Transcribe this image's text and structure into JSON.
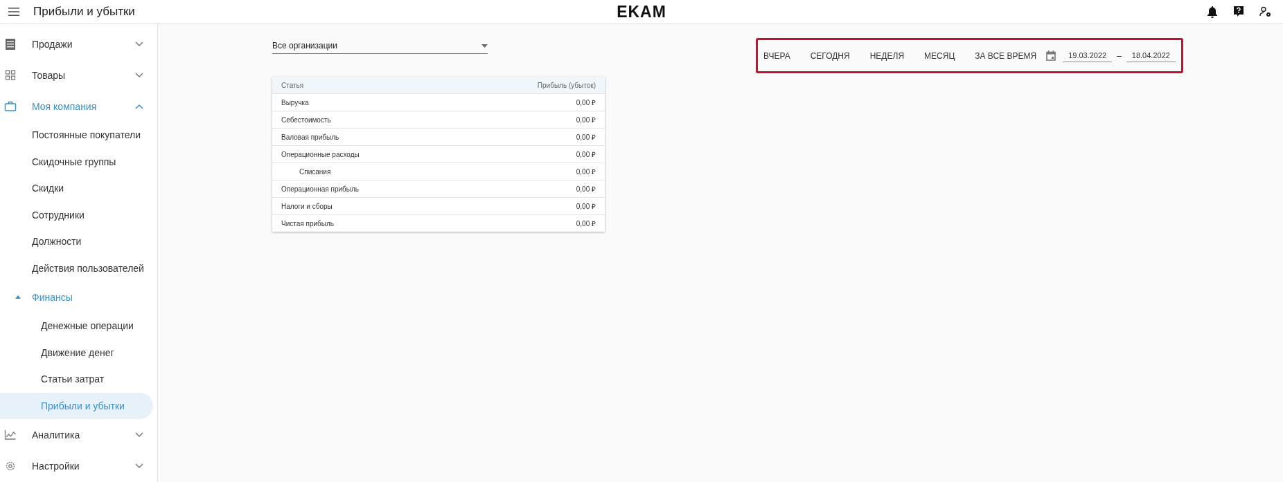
{
  "header": {
    "title": "Прибыли и убытки",
    "logo": "EKAM"
  },
  "sidebar": {
    "items": [
      {
        "label": "Продажи",
        "expanded": false,
        "selected": false
      },
      {
        "label": "Товары",
        "expanded": false,
        "selected": false
      },
      {
        "label": "Моя компания",
        "expanded": true,
        "selected": false,
        "children": [
          {
            "label": "Постоянные покупатели",
            "selected": false
          },
          {
            "label": "Скидочные группы",
            "selected": false
          },
          {
            "label": "Скидки",
            "selected": false
          },
          {
            "label": "Сотрудники",
            "selected": false
          },
          {
            "label": "Должности",
            "selected": false
          },
          {
            "label": "Действия пользователей",
            "selected": false
          },
          {
            "label": "Финансы",
            "expanded": true,
            "selected": false,
            "children": [
              {
                "label": "Денежные операции",
                "selected": false
              },
              {
                "label": "Движение денег",
                "selected": false
              },
              {
                "label": "Статьи затрат",
                "selected": false
              },
              {
                "label": "Прибыли и убытки",
                "selected": true
              }
            ]
          }
        ]
      },
      {
        "label": "Аналитика",
        "expanded": false,
        "selected": false
      },
      {
        "label": "Настройки",
        "expanded": false,
        "selected": false
      }
    ]
  },
  "organization_select": {
    "value": "Все организации"
  },
  "period_filter": {
    "periods": [
      "ВЧЕРА",
      "СЕГОДНЯ",
      "НЕДЕЛЯ",
      "МЕСЯЦ",
      "ЗА ВСЕ ВРЕМЯ"
    ],
    "date_from": "19.03.2022",
    "separator": "–",
    "date_to": "18.04.2022"
  },
  "table": {
    "columns": [
      "Статья",
      "Прибыль (убыток)"
    ],
    "rows": [
      {
        "label": "Выручка",
        "value": "0,00 ₽"
      },
      {
        "label": "Себестоимость",
        "value": "0,00 ₽"
      },
      {
        "label": "Валовая прибыль",
        "value": "0,00 ₽"
      },
      {
        "label": "Операционные расходы",
        "value": "0,00 ₽",
        "children": [
          {
            "label": "Списания",
            "value": "0,00 ₽"
          }
        ]
      },
      {
        "label": "Операционная прибыль",
        "value": "0,00 ₽"
      },
      {
        "label": "Налоги и сборы",
        "value": "0,00 ₽"
      },
      {
        "label": "Чистая прибыль",
        "value": "0,00 ₽"
      }
    ]
  }
}
